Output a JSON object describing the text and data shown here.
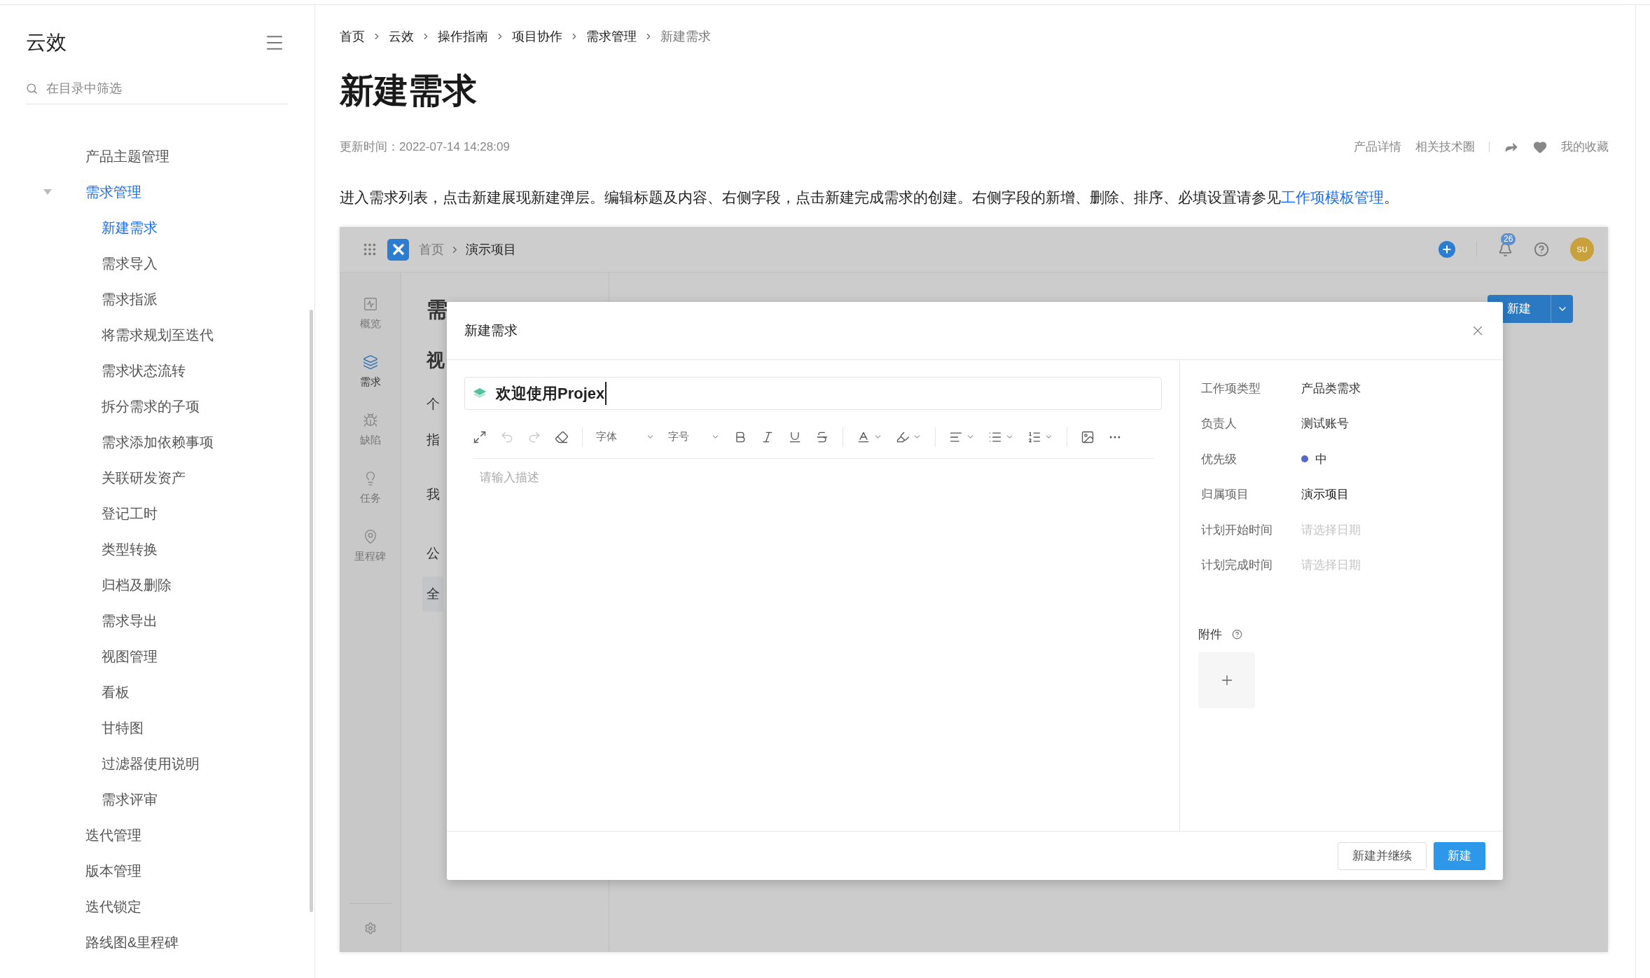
{
  "sidebar": {
    "title": "云效",
    "search": {
      "placeholder": "在目录中筛选"
    },
    "items": [
      {
        "label": "产品主题管理",
        "selected": false
      },
      {
        "label": "需求管理",
        "selected": true,
        "expanded": true,
        "children": [
          {
            "label": "新建需求",
            "selected": true
          },
          {
            "label": "需求导入",
            "selected": false
          },
          {
            "label": "需求指派",
            "selected": false
          },
          {
            "label": "将需求规划至迭代",
            "selected": false
          },
          {
            "label": "需求状态流转",
            "selected": false
          },
          {
            "label": "拆分需求的子项",
            "selected": false
          },
          {
            "label": "需求添加依赖事项",
            "selected": false
          },
          {
            "label": "关联研发资产",
            "selected": false
          },
          {
            "label": "登记工时",
            "selected": false
          },
          {
            "label": "类型转换",
            "selected": false
          },
          {
            "label": "归档及删除",
            "selected": false
          },
          {
            "label": "需求导出",
            "selected": false
          },
          {
            "label": "视图管理",
            "selected": false
          },
          {
            "label": "看板",
            "selected": false
          },
          {
            "label": "甘特图",
            "selected": false
          },
          {
            "label": "过滤器使用说明",
            "selected": false
          },
          {
            "label": "需求评审",
            "selected": false
          }
        ]
      },
      {
        "label": "迭代管理",
        "selected": false
      },
      {
        "label": "版本管理",
        "selected": false
      },
      {
        "label": "迭代锁定",
        "selected": false
      },
      {
        "label": "路线图&里程碑",
        "selected": false
      }
    ]
  },
  "breadcrumb": [
    "首页",
    "云效",
    "操作指南",
    "项目协作",
    "需求管理",
    "新建需求"
  ],
  "article": {
    "title": "新建需求",
    "updated": "更新时间：2022-07-14 14:28:09",
    "links": [
      "产品详情",
      "相关技术圈"
    ],
    "favorite": "我的收藏",
    "intro": "进入需求列表，点击新建展现新建弹层。编辑标题及内容、右侧字段，点击新建完成需求的创建。右侧字段的新增、删除、排序、必填设置请参见",
    "intro_link": "工作项模板管理",
    "intro_end": "。"
  },
  "app": {
    "breadcrumb": [
      "首页",
      "演示项目"
    ],
    "notification_count": "26",
    "avatar": "SU",
    "nav": [
      {
        "label": "概览",
        "selected": false
      },
      {
        "label": "需求",
        "selected": true
      },
      {
        "label": "缺陷",
        "selected": false
      },
      {
        "label": "任务",
        "selected": false
      },
      {
        "label": "里程碑",
        "selected": false
      }
    ],
    "background_fragments": [
      "需",
      "视",
      "个",
      "指",
      "我",
      "公",
      "全"
    ],
    "new_button": "新建",
    "modal": {
      "title": "新建需求",
      "title_field": {
        "value": "欢迎使用Projex"
      },
      "toolbar": {
        "undo": {
          "disabled": true
        },
        "redo": {
          "disabled": true
        },
        "font": "字体",
        "size": "字号"
      },
      "description": {
        "placeholder": "请输入描述"
      },
      "fields": [
        {
          "label": "工作项类型",
          "value": "产品类需求",
          "kind": "text"
        },
        {
          "label": "负责人",
          "value": "测试账号",
          "kind": "text"
        },
        {
          "label": "优先级",
          "value": "中",
          "kind": "priority",
          "color": "#5a66c8"
        },
        {
          "label": "归属项目",
          "value": "演示项目",
          "kind": "strong"
        },
        {
          "label": "计划开始时间",
          "placeholder": "请选择日期",
          "kind": "date"
        },
        {
          "label": "计划完成时间",
          "placeholder": "请选择日期",
          "kind": "date"
        }
      ],
      "attachments_label": "附件",
      "buttons": [
        {
          "label": "新建并继续",
          "primary": false
        },
        {
          "label": "新建",
          "primary": true
        }
      ]
    }
  }
}
